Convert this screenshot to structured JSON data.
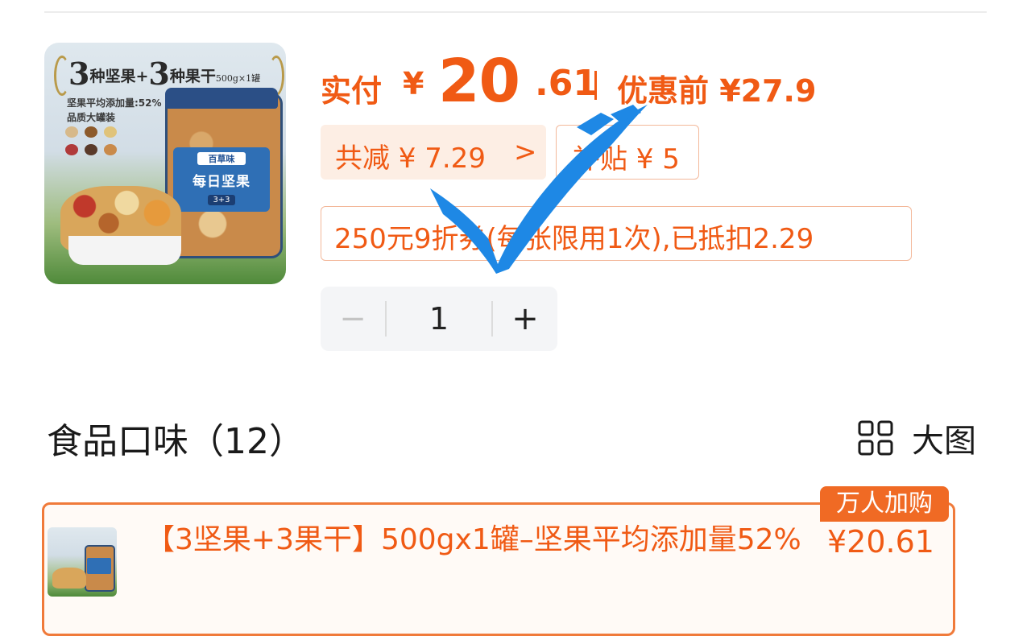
{
  "product_image": {
    "headline_num1": "3",
    "headline_text1": "种坚果+",
    "headline_num2": "3",
    "headline_text2": "种果干",
    "headline_spec": "500g×1罐",
    "sub_line1": "坚果平均添加量:52%",
    "sub_line2": "品质大罐装",
    "brand": "百草味",
    "jar_name": "每日坚果",
    "jar_badge": "3+3"
  },
  "price": {
    "label": "实付",
    "currency": "¥",
    "integer": "20",
    "decimal": ".61",
    "before_label": "优惠前 ¥27.9"
  },
  "savings": {
    "total_label": "共减 ¥ 7.29",
    "chevron": ">",
    "subsidy_label": "补贴 ¥ 5"
  },
  "coupon": {
    "text": "250元9折券(每张限用1次),已抵扣2.29"
  },
  "quantity": {
    "minus": "−",
    "value": "1",
    "plus": "+"
  },
  "flavor_section": {
    "title": "食品口味（12）",
    "big_view_label": "大图",
    "big_view_icon": "grid-icon"
  },
  "flavor_option": {
    "name": "【3坚果+3果干】500gx1罐–坚果平均添加量52%",
    "price": "¥20.61",
    "badge": "万人加购",
    "selected": true
  },
  "overlay": {
    "icon": "checkmark-icon",
    "color": "#1e88e5"
  }
}
